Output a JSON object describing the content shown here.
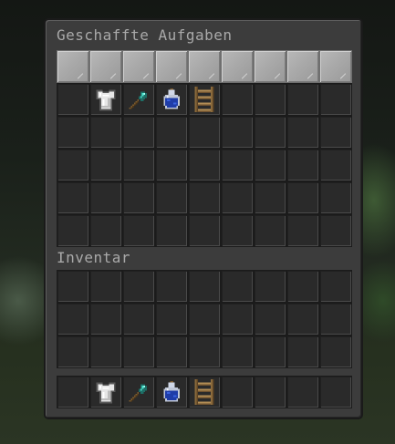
{
  "crafted_section": {
    "title": "Geschaffte Aufgaben",
    "template_row": [
      "",
      "",
      "",
      "",
      "",
      "",
      "",
      "",
      ""
    ],
    "rows": [
      [
        "",
        "chestplate-icon",
        "diamond-shovel-icon",
        "potion-icon",
        "ladder-icon",
        "",
        "",
        "",
        ""
      ],
      [
        "",
        "",
        "",
        "",
        "",
        "",
        "",
        "",
        ""
      ],
      [
        "",
        "",
        "",
        "",
        "",
        "",
        "",
        "",
        ""
      ],
      [
        "",
        "",
        "",
        "",
        "",
        "",
        "",
        "",
        ""
      ],
      [
        "",
        "",
        "",
        "",
        "",
        "",
        "",
        "",
        ""
      ]
    ]
  },
  "inventory_section": {
    "title": "Inventar",
    "rows": [
      [
        "",
        "",
        "",
        "",
        "",
        "",
        "",
        "",
        ""
      ],
      [
        "",
        "",
        "",
        "",
        "",
        "",
        "",
        "",
        ""
      ],
      [
        "",
        "",
        "",
        "",
        "",
        "",
        "",
        "",
        ""
      ]
    ],
    "hotbar": [
      "",
      "chestplate-icon",
      "diamond-shovel-icon",
      "potion-icon",
      "ladder-icon",
      "",
      "",
      "",
      ""
    ]
  },
  "colors": {
    "panel": "#3c3c3c",
    "slot": "#2a2a2a",
    "template_slot": "#a9a9a9",
    "title_text": "#a9a9a9"
  }
}
